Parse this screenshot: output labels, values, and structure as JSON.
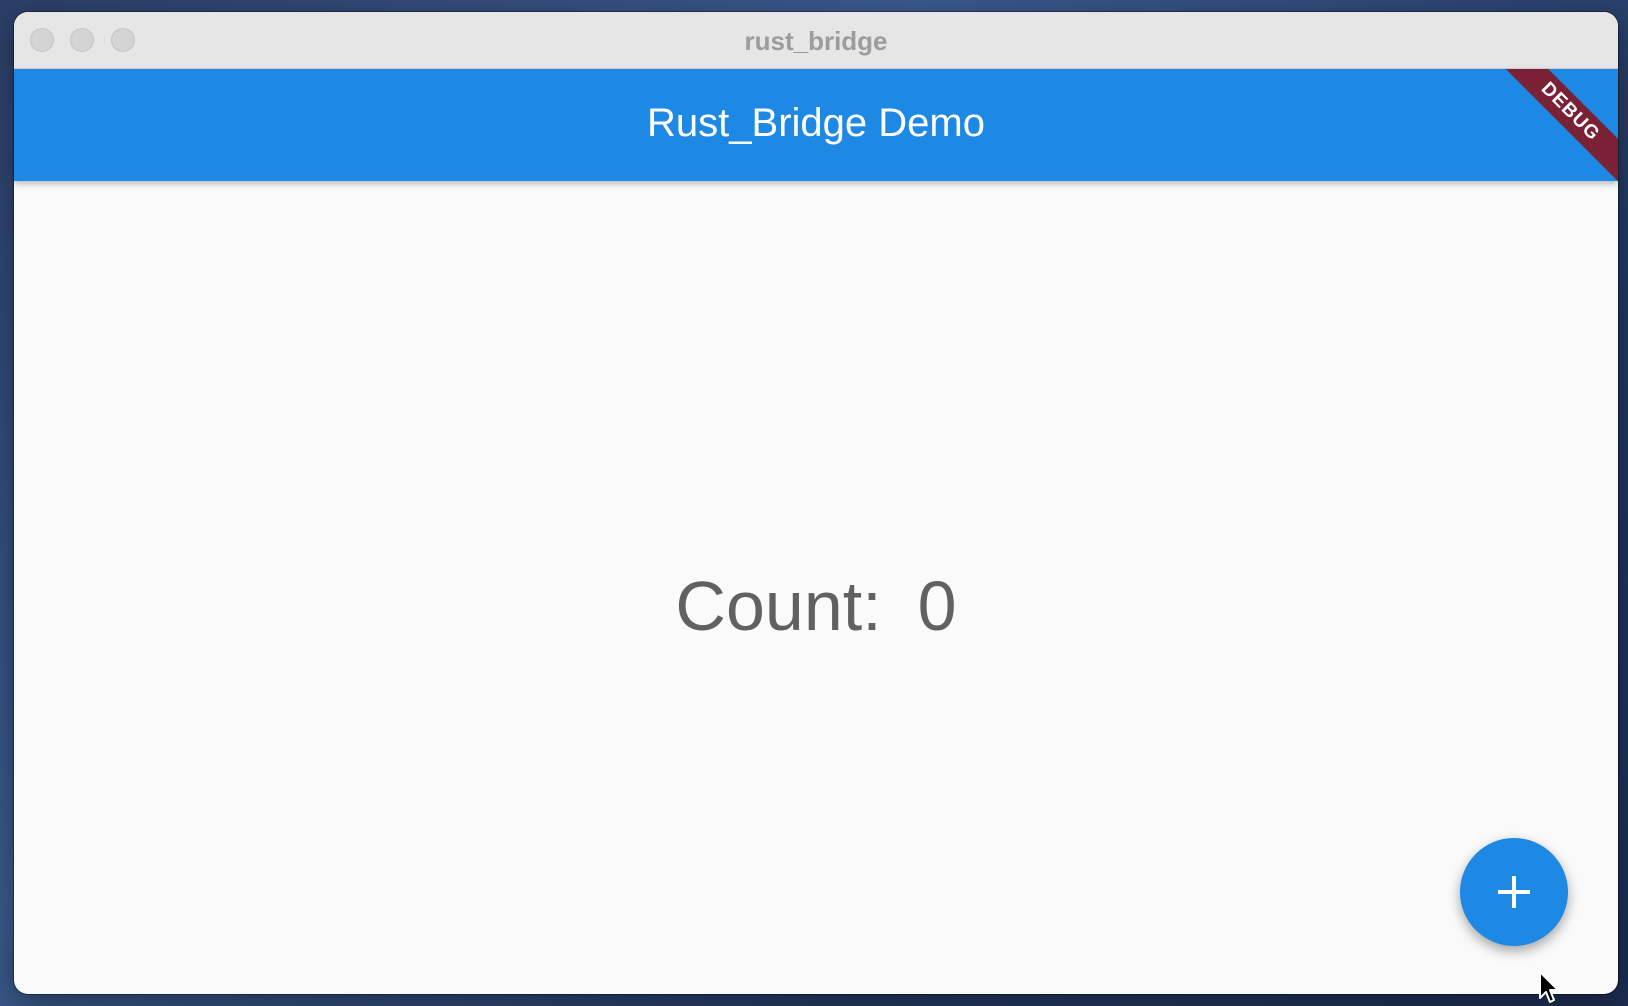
{
  "window": {
    "title": "rust_bridge",
    "controls": [
      "close",
      "minimize",
      "zoom"
    ]
  },
  "app_bar": {
    "title": "Rust_Bridge Demo",
    "color": "#1e88e5"
  },
  "debug_banner": {
    "label": "DEBUG",
    "color": "#7a2136"
  },
  "counter": {
    "label": "Count:",
    "value": "0"
  },
  "fab": {
    "icon": "plus-icon",
    "color": "#1e88e5"
  },
  "cursor": {
    "icon": "arrow-cursor-icon"
  }
}
